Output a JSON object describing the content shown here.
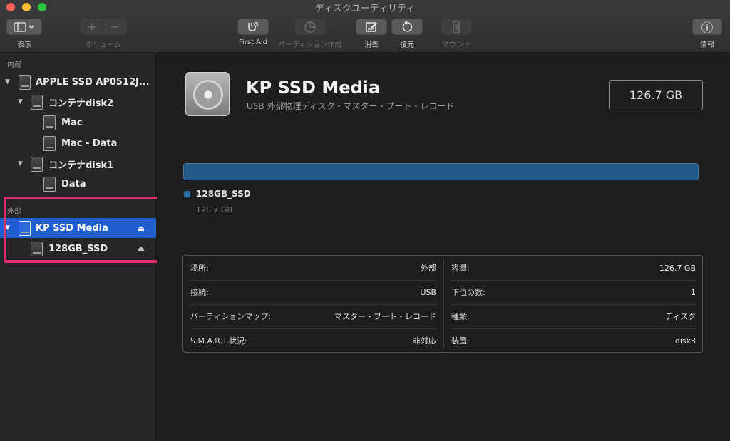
{
  "window": {
    "title": "ディスクユーティリティ"
  },
  "toolbar": {
    "view_label": "表示",
    "volume_label": "ボリューム",
    "first_aid_label": "First Aid",
    "partition_label": "パーティション作成",
    "erase_label": "消去",
    "restore_label": "復元",
    "mount_label": "マウント",
    "info_label": "情報",
    "add_icon": "+",
    "remove_icon": "−",
    "info_icon": "ⓘ"
  },
  "sidebar": {
    "internal_header": "内蔵",
    "external_header": "外部",
    "internal": [
      {
        "label": "APPLE SSD AP0512J...",
        "icon": "internal-disk-icon"
      },
      {
        "label": "コンテナdisk2",
        "icon": "container-icon"
      },
      {
        "label": "Mac",
        "icon": "volume-icon"
      },
      {
        "label": "Mac - Data",
        "icon": "volume-icon"
      },
      {
        "label": "コンテナdisk1",
        "icon": "container-icon"
      },
      {
        "label": "Data",
        "icon": "volume-icon"
      }
    ],
    "external": [
      {
        "label": "KP SSD Media",
        "icon": "external-disk-icon",
        "selected": true
      },
      {
        "label": "128GB_SSD",
        "icon": "volume-icon"
      }
    ],
    "eject_glyph": "⏏",
    "disclosure_glyph": "▼"
  },
  "device": {
    "name": "KP SSD Media",
    "subtitle": "USB 外部物理ディスク・マスター・ブート・レコード",
    "capacity": "126.7 GB"
  },
  "partition": {
    "name": "128GB_SSD",
    "size": "126.7 GB",
    "color": "#2c6fa8"
  },
  "info": {
    "left": [
      {
        "key": "場所:",
        "value": "外部"
      },
      {
        "key": "接続:",
        "value": "USB"
      },
      {
        "key": "パーティションマップ:",
        "value": "マスター・ブート・レコード"
      },
      {
        "key": "S.M.A.R.T.状況:",
        "value": "非対応"
      }
    ],
    "right": [
      {
        "key": "容量:",
        "value": "126.7 GB"
      },
      {
        "key": "下位の数:",
        "value": "1"
      },
      {
        "key": "種類:",
        "value": "ディスク"
      },
      {
        "key": "装置:",
        "value": "disk3"
      }
    ]
  },
  "colors": {
    "selection": "#1f5fd1",
    "highlight_box": "#e62a70",
    "usage_bar": "#245a88"
  }
}
